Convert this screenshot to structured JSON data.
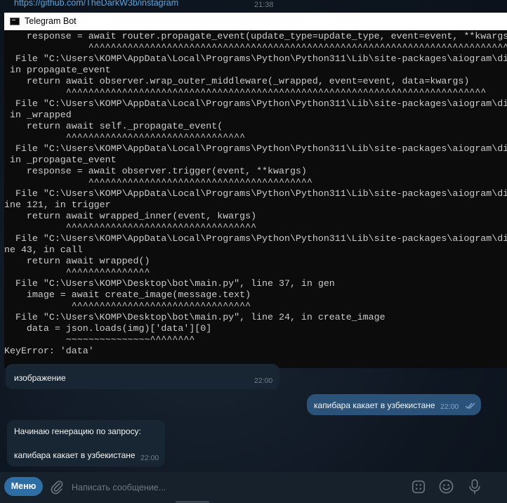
{
  "top": {
    "link_text": "https://github.com/TheDarkW3b/instagram",
    "time": "21:38"
  },
  "console": {
    "title": "Telegram Bot",
    "lines": [
      "    response = await router.propagate_event(update_type=update_type, event=event, **kwargs",
      "               ^^^^^^^^^^^^^^^^^^^^^^^^^^^^^^^^^^^^^^^^^^^^^^^^^^^^^^^^^^^^^^^^^^^^^^^^^^^^^^^^",
      "  File \"C:\\Users\\KOMP\\AppData\\Local\\Programs\\Python\\Python311\\Lib\\site-packages\\aiogram\\di",
      " in propagate_event",
      "    return await observer.wrap_outer_middleware(_wrapped, event=event, data=kwargs)",
      "           ^^^^^^^^^^^^^^^^^^^^^^^^^^^^^^^^^^^^^^^^^^^^^^^^^^^^^^^^^^^^^^^^^^^^^^^^^^^",
      "  File \"C:\\Users\\KOMP\\AppData\\Local\\Programs\\Python\\Python311\\Lib\\site-packages\\aiogram\\di",
      " in _wrapped",
      "    return await self._propagate_event(",
      "           ^^^^^^^^^^^^^^^^^^^^^^^^^^^^^^^^",
      "  File \"C:\\Users\\KOMP\\AppData\\Local\\Programs\\Python\\Python311\\Lib\\site-packages\\aiogram\\di",
      " in _propagate_event",
      "    response = await observer.trigger(event, **kwargs)",
      "               ^^^^^^^^^^^^^^^^^^^^^^^^^^^^^^^^^^^^^^^^",
      "  File \"C:\\Users\\KOMP\\AppData\\Local\\Programs\\Python\\Python311\\Lib\\site-packages\\aiogram\\di",
      "ine 121, in trigger",
      "    return await wrapped_inner(event, kwargs)",
      "           ^^^^^^^^^^^^^^^^^^^^^^^^^^^^^^^^^^",
      "  File \"C:\\Users\\KOMP\\AppData\\Local\\Programs\\Python\\Python311\\Lib\\site-packages\\aiogram\\di",
      "ne 43, in call",
      "    return await wrapped()",
      "           ^^^^^^^^^^^^^^^",
      "  File \"C:\\Users\\KOMP\\Desktop\\bot\\main.py\", line 37, in gen",
      "    image = await create_image(message.text)",
      "            ^^^^^^^^^^^^^^^^^^^^^^^^^^^^^^^^",
      "  File \"C:\\Users\\KOMP\\Desktop\\bot\\main.py\", line 24, in create_image",
      "    data = json.loads(img)['data'][0]",
      "           ~~~~~~~~~~~~~~~^^^^^^^^",
      "KeyError: 'data'"
    ]
  },
  "messages": {
    "bot_partial": {
      "text": "изображение",
      "time": "22:00"
    },
    "user": {
      "text": "капибара какает в узбекистане",
      "time": "22:00"
    },
    "bot_reply": {
      "line1": "Начинаю генерацию по запросу:",
      "line2": "капибара какает в узбекистане",
      "time": "22:00"
    }
  },
  "input_bar": {
    "menu_label": "Меню",
    "placeholder": "Написать сообщение..."
  },
  "colors": {
    "chat_bg": "#0e1621",
    "bubble_in": "#182533",
    "bubble_out": "#2b5278",
    "accent": "#2f6ea5",
    "console_bg": "#0c0c0c"
  },
  "icons": [
    "console-app-icon",
    "paperclip-icon",
    "bot-commands-icon",
    "emoji-icon",
    "microphone-icon",
    "double-check-icon"
  ]
}
